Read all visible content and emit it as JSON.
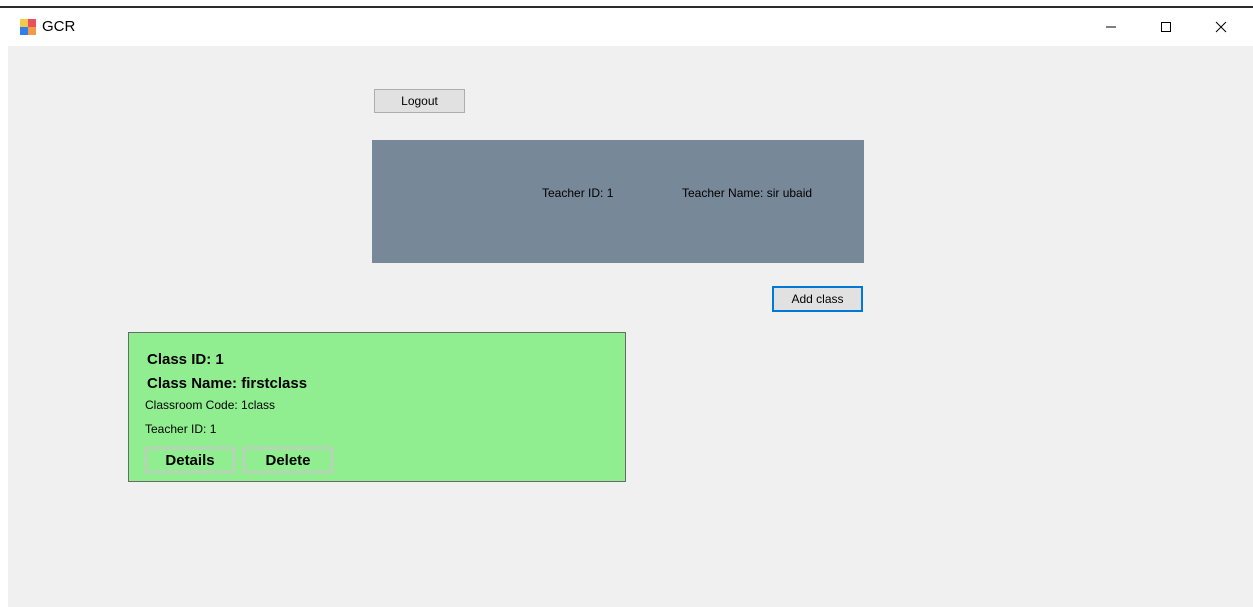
{
  "window": {
    "title": "GCR",
    "icon": "app-icon",
    "controls": [
      "minimize-icon",
      "maximize-icon",
      "close-icon"
    ]
  },
  "toolbar": {
    "logout_label": "Logout",
    "add_class_label": "Add class"
  },
  "teacher_panel": {
    "teacher_id": "Teacher ID: 1",
    "teacher_name": "Teacher Name: sir ubaid",
    "background": "#778899"
  },
  "classes": [
    {
      "class_id": "Class ID: 1",
      "class_name": "Class Name: firstclass",
      "classroom_code": "Classroom Code: 1class",
      "teacher_id": "Teacher ID: 1",
      "details_label": "Details",
      "delete_label": "Delete",
      "background": "#90ee90"
    }
  ],
  "colors": {
    "client_background": "#f0f0f0",
    "focus_border": "#0078d7"
  }
}
